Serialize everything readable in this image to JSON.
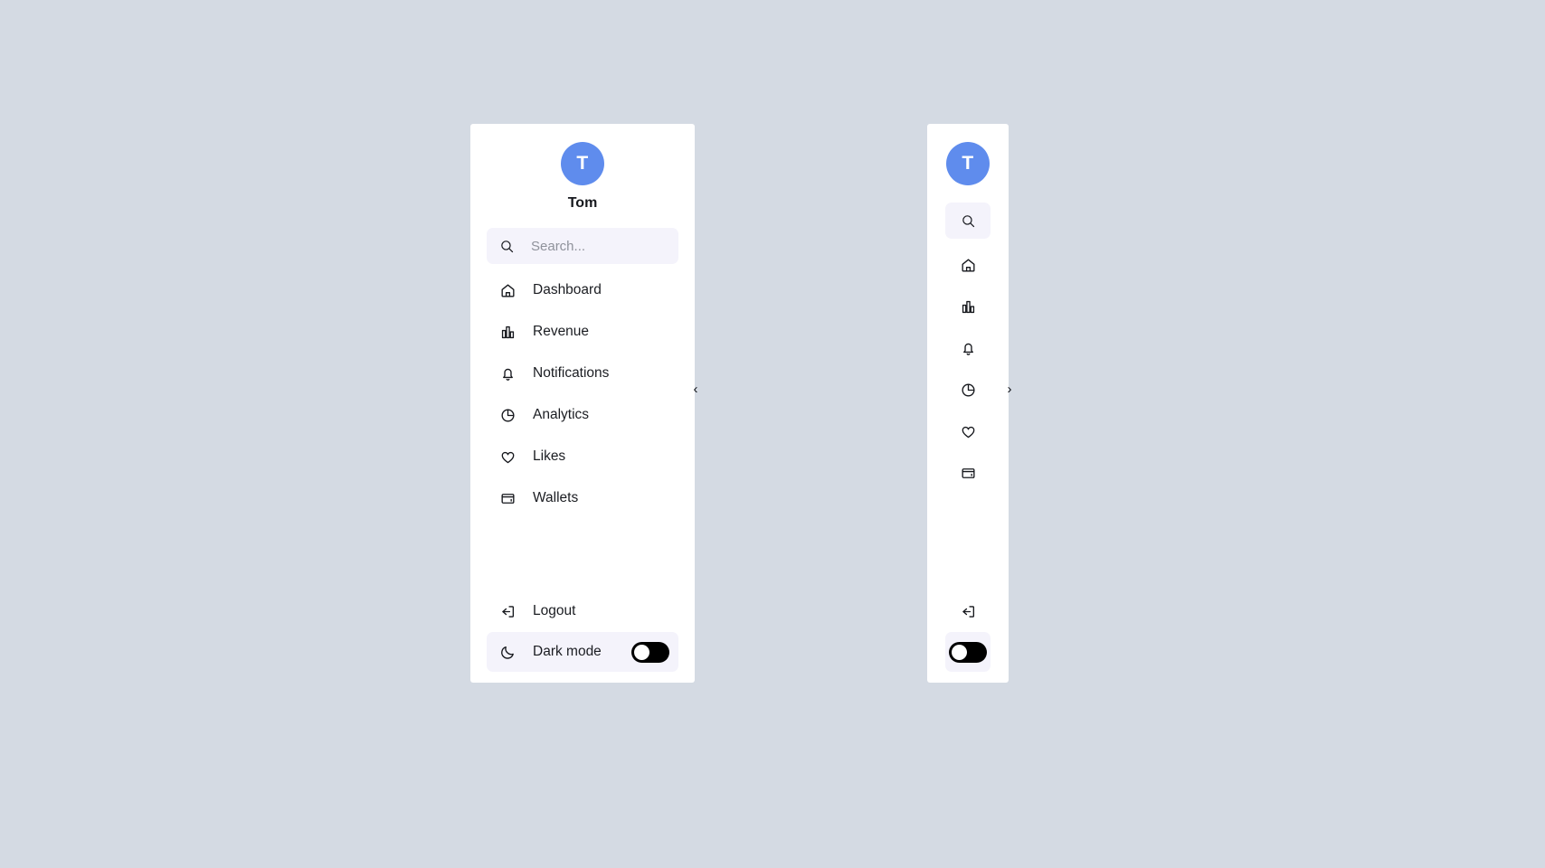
{
  "page": {
    "background_color": "#d4dae3",
    "accent_color": "#5f8ced",
    "highlight_color": "#f4f3fb"
  },
  "sidebar": {
    "profile": {
      "avatar_initial": "T",
      "name": "Tom"
    },
    "search": {
      "placeholder": "Search...",
      "value": "",
      "icon": "search-icon"
    },
    "items": [
      {
        "label": "Dashboard",
        "icon": "home-icon"
      },
      {
        "label": "Revenue",
        "icon": "bar-chart-icon"
      },
      {
        "label": "Notifications",
        "icon": "bell-icon"
      },
      {
        "label": "Analytics",
        "icon": "pie-chart-icon"
      },
      {
        "label": "Likes",
        "icon": "heart-icon"
      },
      {
        "label": "Wallets",
        "icon": "wallet-icon"
      }
    ],
    "logout": {
      "label": "Logout",
      "icon": "logout-icon"
    },
    "dark_mode": {
      "label": "Dark mode",
      "icon": "moon-icon",
      "enabled": false
    },
    "collapse_handle": {
      "glyph": "‹",
      "icon": "chevron-left-icon"
    }
  },
  "sidebar_collapsed": {
    "profile": {
      "avatar_initial": "T"
    },
    "search": {
      "icon": "search-icon"
    },
    "items": [
      {
        "icon": "home-icon"
      },
      {
        "icon": "bar-chart-icon"
      },
      {
        "icon": "bell-icon"
      },
      {
        "icon": "pie-chart-icon"
      },
      {
        "icon": "heart-icon"
      },
      {
        "icon": "wallet-icon"
      }
    ],
    "logout": {
      "icon": "logout-icon"
    },
    "dark_mode": {
      "icon": "moon-icon",
      "enabled": false
    },
    "expand_handle": {
      "glyph": "›",
      "icon": "chevron-right-icon"
    }
  }
}
